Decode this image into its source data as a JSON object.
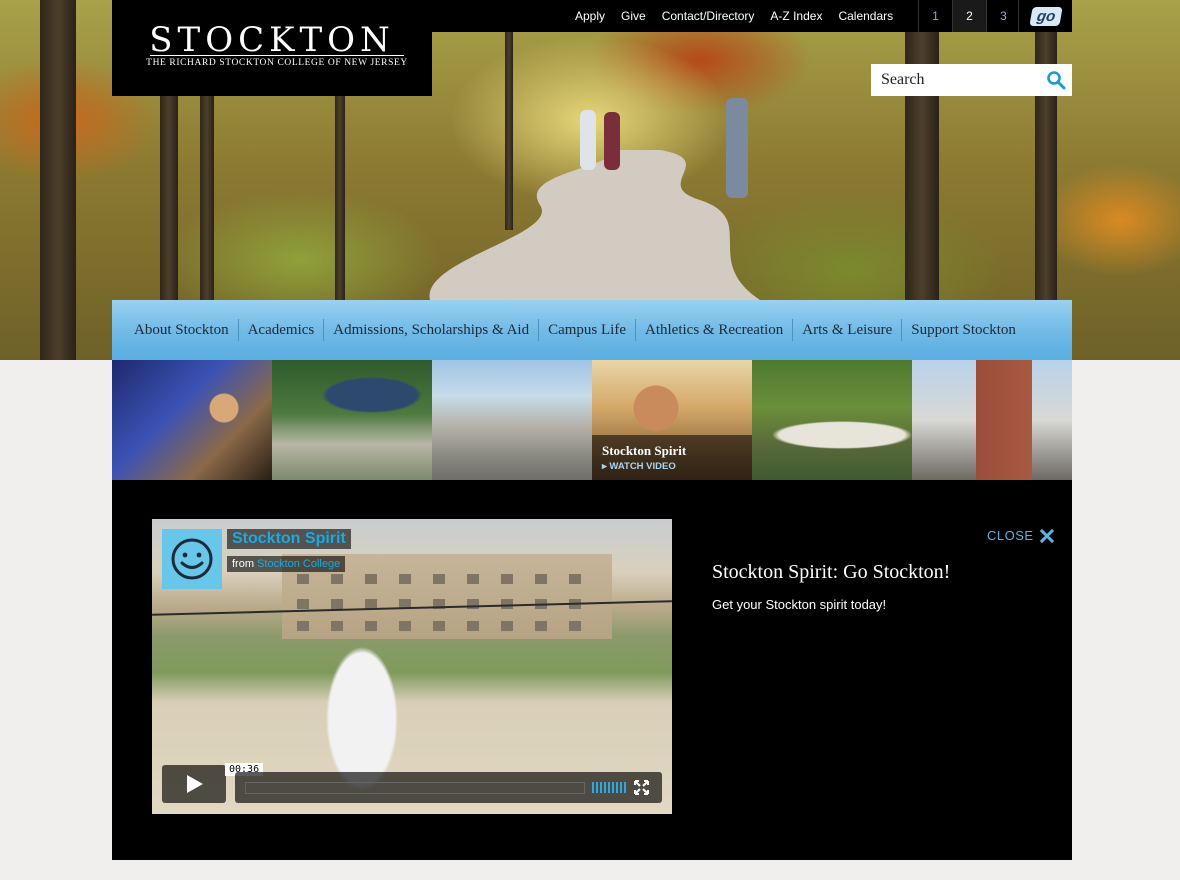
{
  "logo": {
    "name": "STOCKTON",
    "subtitle": "THE RICHARD STOCKTON COLLEGE OF NEW JERSEY"
  },
  "utility_nav": [
    "Apply",
    "Give",
    "Contact/Directory",
    "A-Z Index",
    "Calendars"
  ],
  "pager": {
    "pages": [
      "1",
      "2",
      "3"
    ],
    "active": "2",
    "go_label": "go"
  },
  "search": {
    "placeholder": "Search"
  },
  "main_nav": [
    "About Stockton",
    "Academics",
    "Admissions, Scholarships & Aid",
    "Campus Life",
    "Athletics & Recreation",
    "Arts & Leisure",
    "Support Stockton"
  ],
  "feature_thumb": {
    "title": "Stockton Spirit",
    "action": "WATCH VIDEO"
  },
  "video": {
    "title": "Stockton Spirit",
    "from_prefix": "from",
    "from_name": "Stockton College",
    "timecode": "00:36"
  },
  "panel": {
    "close_label": "CLOSE",
    "heading": "Stockton Spirit: Go Stockton!",
    "description": "Get your Stockton spirit today!"
  },
  "colors": {
    "nav_blue": "#6fb9e6",
    "link_blue": "#5fb3e3",
    "video_accent": "#1aa9e0",
    "panel_bg": "#000000"
  }
}
